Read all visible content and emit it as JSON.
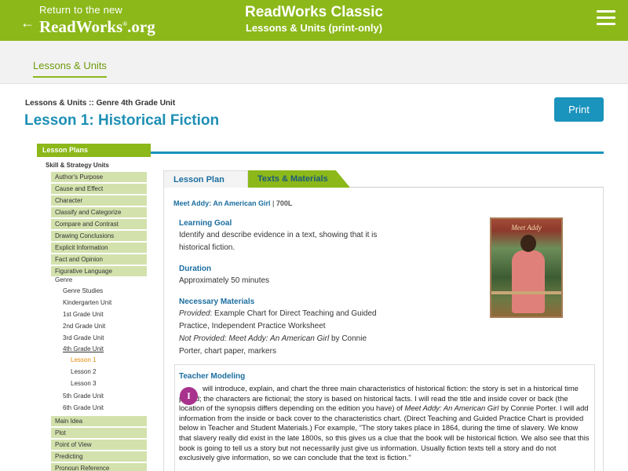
{
  "topbar": {
    "back_line1": "Return to the new",
    "back_line2": "ReadWorks",
    "back_reg": "®",
    "back_line2_suffix": ".org",
    "brand_title": "ReadWorks Classic",
    "brand_subtitle": "Lessons & Units (print-only)",
    "colors": {
      "bar": "#8cb81a",
      "accent_blue": "#1a93bd"
    }
  },
  "subnav": {
    "tab": "Lessons & Units"
  },
  "header": {
    "breadcrumb": "Lessons & Units :: Genre 4th Grade Unit",
    "title": "Lesson 1: Historical Fiction",
    "print_label": "Print"
  },
  "sidebar": {
    "heading": "Lesson Plans",
    "group": "Skill & Strategy Units",
    "items_top": [
      "Author's Purpose",
      "Cause and Effect",
      "Character",
      "Classify and Categorize",
      "Compare and Contrast",
      "Drawing Conclusions",
      "Explicit Information",
      "Fact and Opinion",
      "Figurative Language"
    ],
    "genre": "Genre",
    "genre_children": [
      "Genre Studies",
      "Kindergarten Unit",
      "1st Grade Unit",
      "2nd Grade Unit",
      "3rd Grade Unit",
      "4th Grade Unit"
    ],
    "lessons": [
      "Lesson 1",
      "Lesson 2",
      "Lesson 3"
    ],
    "genre_after": [
      "5th Grade Unit",
      "6th Grade Unit"
    ],
    "items_bottom": [
      "Main Idea",
      "Plot",
      "Point of View",
      "Predicting",
      "Pronoun Reference"
    ]
  },
  "tabs": {
    "plan": "Lesson Plan",
    "texts": "Texts & Materials"
  },
  "lesson": {
    "text_title": "Meet Addy: An American Girl",
    "separator": " | ",
    "lexile": "700L",
    "goal_heading": "Learning Goal",
    "goal_text": "Identify and describe evidence in a text, showing that it is historical fiction.",
    "duration_heading": "Duration",
    "duration_text": "Approximately 50 minutes",
    "materials_heading": "Necessary Materials",
    "provided_label": "Provided",
    "provided_text": ": Example Chart for Direct Teaching and Guided Practice, Independent Practice Worksheet",
    "not_provided_label": "Not Provided",
    "not_provided_book": ": Meet Addy: An American Girl",
    "not_provided_text": " by Connie Porter, chart paper, markers",
    "book_cover_title": "Meet Addy"
  },
  "teacher_modeling": {
    "heading": "Teacher Modeling",
    "drop_cap": "I",
    "text_a": "will introduce, explain, and chart the three main characteristics of historical fiction: the story is set in a historical time period; the characters are fictional; the story is based on historical facts. I will read the title and inside cover or back (the location of the synopsis differs depending on the edition you have) of ",
    "text_book": "Meet Addy: An American Girl",
    "text_b": " by Connie Porter. I will add information from the inside or back cover to the characteristics chart. (Direct Teaching and Guided Practice Chart is provided below in Teacher and Student Materials.) For example, \"The story takes place in 1864, during the time of slavery. We know that slavery really did exist in the late 1800s, so this gives us a clue that the book will be historical fiction. We also see that this book is going to tell us a story but not necessarily just give us information. Usually fiction texts tell a story and do not exclusively give information, so we can conclude that the text is fiction.\""
  }
}
